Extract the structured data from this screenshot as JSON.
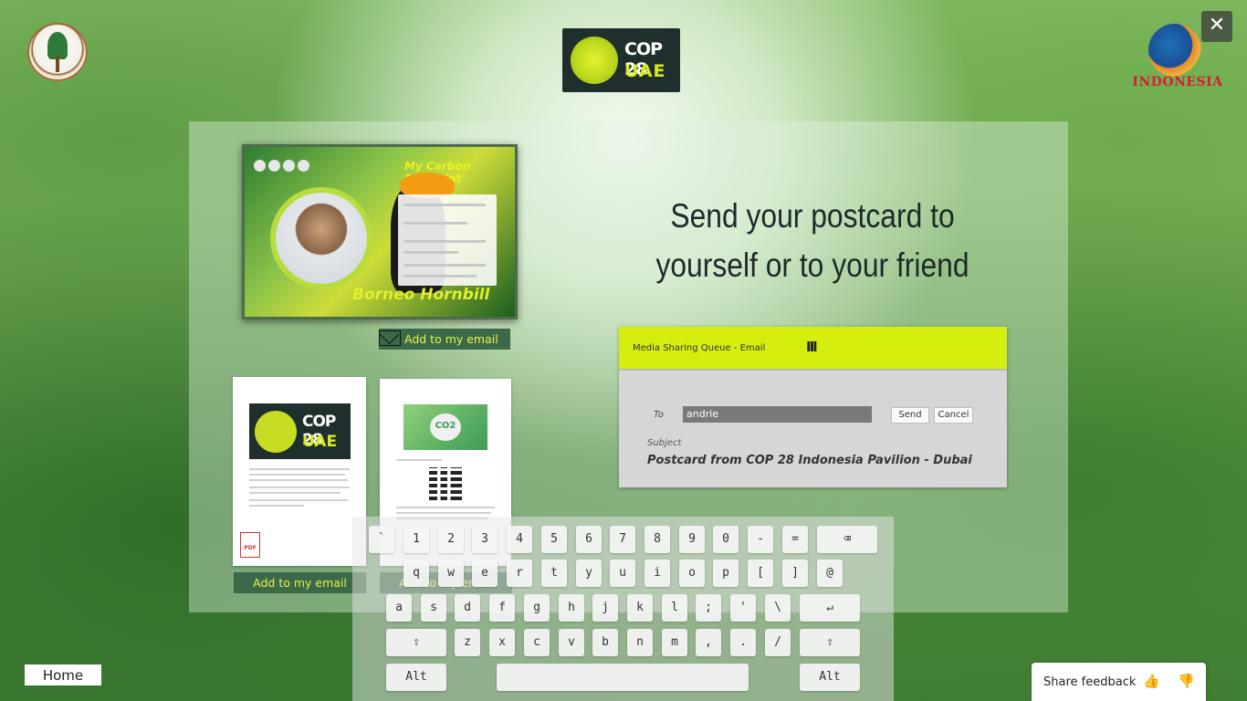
{
  "top": {
    "close_glyph": "✕",
    "cop_logo": {
      "line1": "COP 28",
      "line2": "UAE"
    },
    "right_logo_text": "INDONESIA"
  },
  "postcard": {
    "title": "My Carbon Footprint",
    "name": "Borneo Hornbill",
    "email_button": "Add to my email"
  },
  "documents": [
    {
      "email_button": "Add to my email",
      "banner_line1": "COP 28",
      "banner_line2": "UAE",
      "pdf_label": "PDF"
    },
    {
      "email_button": "Add to my email",
      "banner_text": "CO2"
    }
  ],
  "headline": {
    "line1": "Send your postcard to",
    "line2": "yourself or to your friend"
  },
  "dialog": {
    "title": "Media Sharing Queue - Email",
    "grip": "III",
    "to_label": "To",
    "to_value": "andrie",
    "send": "Send",
    "cancel": "Cancel",
    "subject_label": "Subject",
    "subject_value": "Postcard from COP 28 Indonesia Pavilion - Dubai"
  },
  "keyboard": {
    "row1": [
      "`",
      "1",
      "2",
      "3",
      "4",
      "5",
      "6",
      "7",
      "8",
      "9",
      "0",
      "-",
      "="
    ],
    "row2": [
      "q",
      "w",
      "e",
      "r",
      "t",
      "y",
      "u",
      "i",
      "o",
      "p",
      "[",
      "]",
      "@"
    ],
    "row3": [
      "a",
      "s",
      "d",
      "f",
      "g",
      "h",
      "j",
      "k",
      "l",
      ";",
      "'",
      "\\"
    ],
    "row4": [
      "z",
      "x",
      "c",
      "v",
      "b",
      "n",
      "m",
      ",",
      ".",
      "/"
    ],
    "backspace": "⌫",
    "enter": "↵",
    "shift": "⇧",
    "alt": "Alt"
  },
  "bottom": {
    "home": "Home",
    "feedback": "Share feedback",
    "thumbs_up": "👍",
    "thumbs_down": "👎"
  },
  "colors": {
    "accent_yellow": "#d6ee0d",
    "button_green": "#3c6a49",
    "button_text": "#e8f04a"
  }
}
